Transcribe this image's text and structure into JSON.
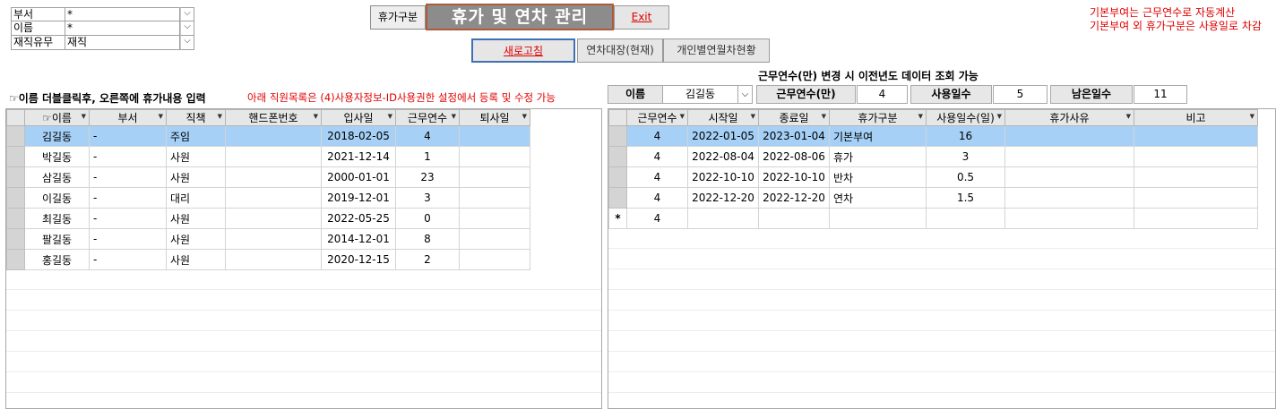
{
  "filter": {
    "rows": [
      {
        "label": "부서",
        "value": "*"
      },
      {
        "label": "이름",
        "value": "*"
      },
      {
        "label": "재직유무",
        "value": "재직"
      }
    ],
    "dropdown_icon": "chevron-down-icon"
  },
  "header": {
    "type_label": "휴가구분",
    "title": "휴가 및 연차 관리",
    "exit_label": "Exit",
    "refresh_label": "새로고침",
    "ledger_label": "연차대장(현재)",
    "status_label": "개인별연월차현황"
  },
  "notes": {
    "top_right_1": "기본부여는 근무연수로 자동계산",
    "top_right_2": "기본부여 외 휴가구분은 사용일로 차감",
    "left_instruction": "☞이름 더블클릭후, 오른쪽에 휴가내용 입력",
    "left_red": "아래 직원목록은 (4)사용자정보-ID사용권한 설정에서 등록 및 수정 가능",
    "right_center": "근무연수(만) 변경 시 이전년도 데이터 조회 가능"
  },
  "info_bar": {
    "name_label": "이름",
    "name_value": "김길동",
    "years_label": "근무연수(만)",
    "years_value": "4",
    "used_label": "사용일수",
    "used_value": "5",
    "remain_label": "남은일수",
    "remain_value": "11"
  },
  "employees": {
    "columns": [
      "☞이름",
      "부서",
      "직책",
      "핸드폰번호",
      "입사일",
      "근무연수",
      "퇴사일"
    ],
    "rows": [
      {
        "name": "김길동",
        "dept": "-",
        "position": "주임",
        "phone": "",
        "hire": "2018-02-05",
        "years": "4",
        "leave": ""
      },
      {
        "name": "박길동",
        "dept": "-",
        "position": "사원",
        "phone": "",
        "hire": "2021-12-14",
        "years": "1",
        "leave": ""
      },
      {
        "name": "삼길동",
        "dept": "-",
        "position": "사원",
        "phone": "",
        "hire": "2000-01-01",
        "years": "23",
        "leave": ""
      },
      {
        "name": "이길동",
        "dept": "-",
        "position": "대리",
        "phone": "",
        "hire": "2019-12-01",
        "years": "3",
        "leave": ""
      },
      {
        "name": "최길동",
        "dept": "-",
        "position": "사원",
        "phone": "",
        "hire": "2022-05-25",
        "years": "0",
        "leave": ""
      },
      {
        "name": "팔길동",
        "dept": "-",
        "position": "사원",
        "phone": "",
        "hire": "2014-12-01",
        "years": "8",
        "leave": ""
      },
      {
        "name": "홍길동",
        "dept": "-",
        "position": "사원",
        "phone": "",
        "hire": "2020-12-15",
        "years": "2",
        "leave": ""
      }
    ]
  },
  "leaves": {
    "columns": [
      "근무연수",
      "시작일",
      "종료일",
      "휴가구분",
      "사용일수(일)",
      "휴가사유",
      "비고"
    ],
    "rows": [
      {
        "years": "4",
        "start": "2022-01-05",
        "end": "2023-01-04",
        "type": "기본부여",
        "days": "16",
        "reason": "",
        "note": ""
      },
      {
        "years": "4",
        "start": "2022-08-04",
        "end": "2022-08-06",
        "type": "휴가",
        "days": "3",
        "reason": "",
        "note": ""
      },
      {
        "years": "4",
        "start": "2022-10-10",
        "end": "2022-10-10",
        "type": "반차",
        "days": "0.5",
        "reason": "",
        "note": ""
      },
      {
        "years": "4",
        "start": "2022-12-20",
        "end": "2022-12-20",
        "type": "연차",
        "days": "1.5",
        "reason": "",
        "note": ""
      }
    ],
    "new_row_marker": "*",
    "new_row_years": "4"
  }
}
